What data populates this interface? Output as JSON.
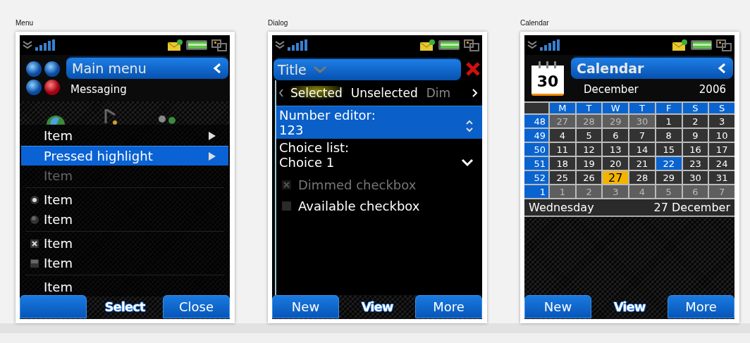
{
  "panels": [
    {
      "caption": "Menu",
      "kind": "menu",
      "title": "Main menu",
      "subtitle": "Messaging",
      "items": [
        {
          "label": "Item",
          "kind": "submenu",
          "pressed": false,
          "dimmed": false
        },
        {
          "label": "Pressed highlight",
          "kind": "submenu",
          "pressed": true,
          "dimmed": false
        },
        {
          "label": "Item",
          "kind": "plain",
          "pressed": false,
          "dimmed": true
        },
        {
          "label": "Item",
          "kind": "radio",
          "pressed": false,
          "dimmed": false,
          "selected": true
        },
        {
          "label": "Item",
          "kind": "radio",
          "pressed": false,
          "dimmed": false,
          "selected": false
        },
        {
          "label": "Item",
          "kind": "checkbox",
          "pressed": false,
          "dimmed": false,
          "checked": true
        },
        {
          "label": "Item",
          "kind": "checkbox",
          "pressed": false,
          "dimmed": false,
          "checked": false
        },
        {
          "label": "Item",
          "kind": "plain",
          "pressed": false,
          "dimmed": false
        }
      ],
      "softkeys": [
        {
          "kind": "button"
        },
        {
          "kind": "text",
          "label": "Select"
        },
        {
          "kind": "button",
          "label": "Close"
        }
      ]
    },
    {
      "caption": "Dialog",
      "kind": "dialog",
      "title": "Title",
      "tabs": [
        {
          "label": "Selected",
          "selected": true,
          "disabled": false
        },
        {
          "label": "Unselected",
          "selected": false,
          "disabled": false
        },
        {
          "label": "Dim",
          "selected": false,
          "disabled": true
        }
      ],
      "fields": [
        {
          "kind": "number",
          "label": "Number editor:",
          "value": "123",
          "focused": true
        },
        {
          "kind": "choice",
          "label": "Choice list:",
          "value": "Choice 1",
          "focused": false
        }
      ],
      "checkboxes": [
        {
          "label": "Dimmed checkbox",
          "checked": true,
          "disabled": true
        },
        {
          "label": "Available checkbox",
          "checked": false,
          "disabled": false
        }
      ],
      "softkeys": [
        {
          "kind": "button",
          "label": "New"
        },
        {
          "kind": "text",
          "label": "View"
        },
        {
          "kind": "button",
          "label": "More"
        }
      ]
    },
    {
      "caption": "Calendar",
      "kind": "calendar",
      "icon_day": "30",
      "title": "Calendar",
      "month": "December",
      "year": "2006",
      "weekdays": [
        "M",
        "T",
        "W",
        "T",
        "F",
        "S",
        "S"
      ],
      "weeks": [
        {
          "week": "48",
          "days": [
            {
              "day": "27",
              "kind": "adjacent"
            },
            {
              "day": "28",
              "kind": "adjacent"
            },
            {
              "day": "29",
              "kind": "adjacent"
            },
            {
              "day": "30",
              "kind": "adjacent"
            },
            {
              "day": "1",
              "kind": "current"
            },
            {
              "day": "2",
              "kind": "current"
            },
            {
              "day": "3",
              "kind": "current"
            }
          ]
        },
        {
          "week": "49",
          "days": [
            {
              "day": "4",
              "kind": "current"
            },
            {
              "day": "5",
              "kind": "current"
            },
            {
              "day": "6",
              "kind": "current"
            },
            {
              "day": "7",
              "kind": "current"
            },
            {
              "day": "8",
              "kind": "current"
            },
            {
              "day": "9",
              "kind": "current"
            },
            {
              "day": "10",
              "kind": "current"
            }
          ]
        },
        {
          "week": "50",
          "days": [
            {
              "day": "11",
              "kind": "current"
            },
            {
              "day": "12",
              "kind": "current"
            },
            {
              "day": "13",
              "kind": "current"
            },
            {
              "day": "14",
              "kind": "current"
            },
            {
              "day": "15",
              "kind": "current"
            },
            {
              "day": "16",
              "kind": "current"
            },
            {
              "day": "17",
              "kind": "current"
            }
          ]
        },
        {
          "week": "51",
          "days": [
            {
              "day": "18",
              "kind": "current"
            },
            {
              "day": "19",
              "kind": "current"
            },
            {
              "day": "20",
              "kind": "current"
            },
            {
              "day": "21",
              "kind": "current"
            },
            {
              "day": "22",
              "kind": "today"
            },
            {
              "day": "23",
              "kind": "current"
            },
            {
              "day": "24",
              "kind": "current"
            }
          ]
        },
        {
          "week": "52",
          "days": [
            {
              "day": "25",
              "kind": "current"
            },
            {
              "day": "26",
              "kind": "current"
            },
            {
              "day": "27",
              "kind": "cursor"
            },
            {
              "day": "28",
              "kind": "current"
            },
            {
              "day": "29",
              "kind": "current"
            },
            {
              "day": "30",
              "kind": "current"
            },
            {
              "day": "31",
              "kind": "current"
            }
          ]
        },
        {
          "week": "1",
          "days": [
            {
              "day": "1",
              "kind": "adjacent"
            },
            {
              "day": "2",
              "kind": "adjacent"
            },
            {
              "day": "3",
              "kind": "adjacent"
            },
            {
              "day": "4",
              "kind": "adjacent"
            },
            {
              "day": "5",
              "kind": "adjacent"
            },
            {
              "day": "6",
              "kind": "adjacent"
            },
            {
              "day": "7",
              "kind": "adjacent"
            }
          ]
        }
      ],
      "footer_day": "Wednesday",
      "footer_date": "27 December",
      "softkeys": [
        {
          "kind": "button",
          "label": "New"
        },
        {
          "kind": "text",
          "label": "View"
        },
        {
          "kind": "button",
          "label": "More"
        }
      ]
    }
  ]
}
